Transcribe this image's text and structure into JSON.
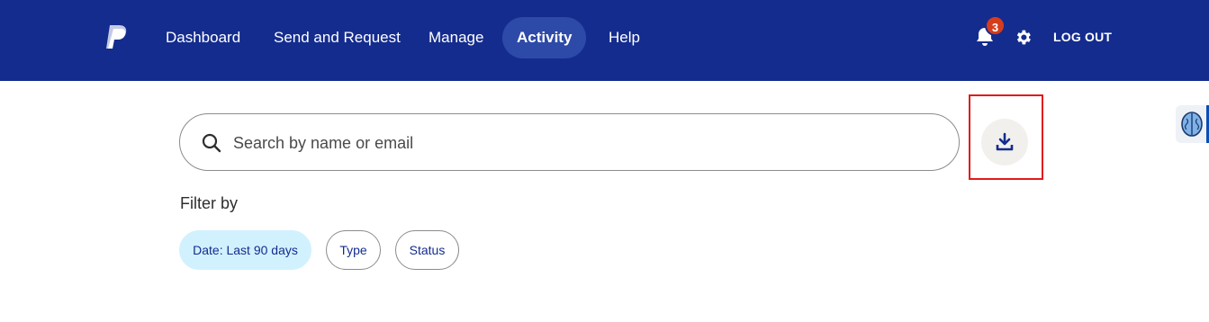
{
  "header": {
    "nav": [
      {
        "label": "Dashboard"
      },
      {
        "label": "Send and Request"
      },
      {
        "label": "Manage"
      },
      {
        "label": "Activity"
      },
      {
        "label": "Help"
      }
    ],
    "active_nav": "Activity",
    "notification_count": "3",
    "logout_label": "LOG OUT"
  },
  "search": {
    "placeholder": "Search by name or email",
    "value": ""
  },
  "filters": {
    "title": "Filter by",
    "chips": [
      {
        "label": "Date: Last 90 days",
        "selected": true
      },
      {
        "label": "Type",
        "selected": false
      },
      {
        "label": "Status",
        "selected": false
      }
    ]
  },
  "icons": {
    "logo": "paypal-logo",
    "bell": "bell-icon",
    "gear": "gear-icon",
    "search": "search-icon",
    "download": "download-icon",
    "side": "brain-icon"
  },
  "colors": {
    "header_bg": "#142c8e",
    "active_nav_bg": "#2e4aa8",
    "badge": "#d63d1c",
    "chip_selected": "#d1f1ff",
    "highlight_box": "#e11a1a"
  }
}
